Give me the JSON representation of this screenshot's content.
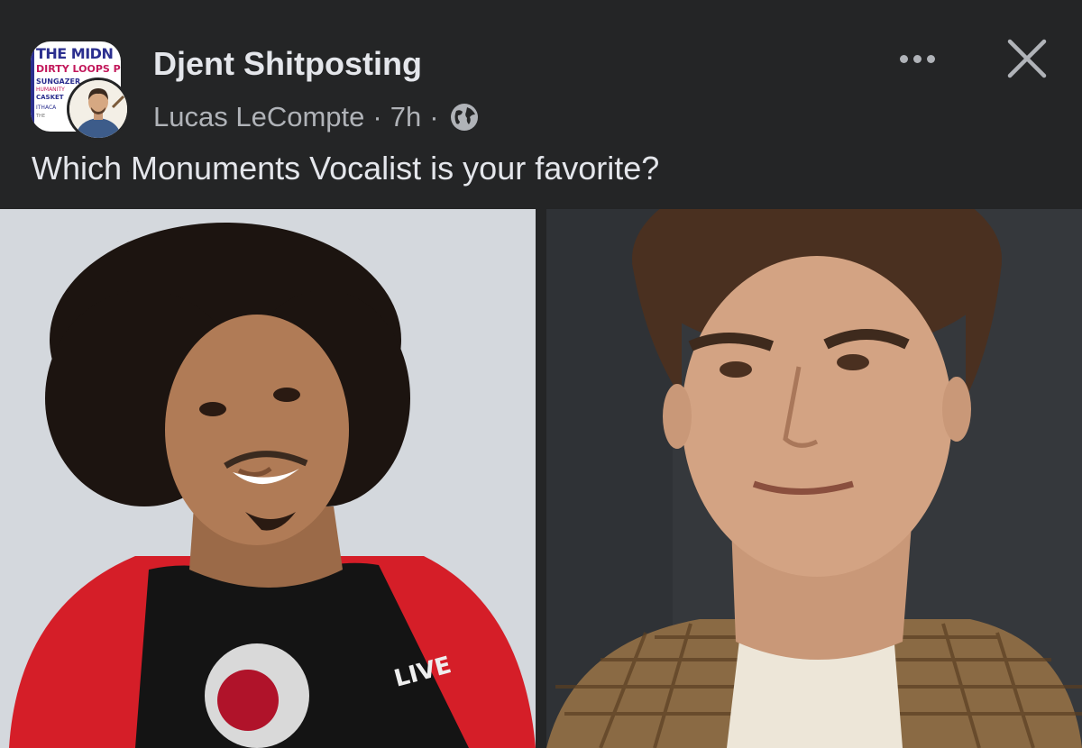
{
  "post": {
    "group_name": "Djent Shitposting",
    "author": "Lucas LeCompte",
    "separator": "·",
    "time": "7h",
    "caption": "Which Monuments Vocalist is your favorite?"
  },
  "group_avatar": {
    "lines": [
      "THE MIDN",
      "DIRTY LOOPS PLIN",
      "SUNGAZER",
      "HUMANITY",
      "CASKET",
      "ITHACA",
      "THE"
    ]
  },
  "icons": {
    "more": "more-horizontal-icon",
    "close": "close-icon",
    "audience": "globe-icon"
  },
  "colors": {
    "background": "#242526",
    "primary_text": "#e4e6eb",
    "secondary_text": "#b0b3b8"
  }
}
